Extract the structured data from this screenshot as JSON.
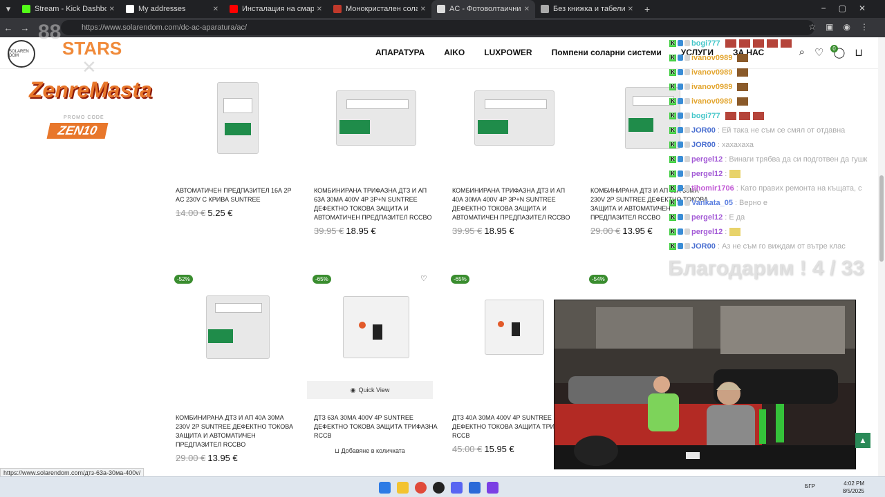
{
  "browser": {
    "tabs": [
      {
        "title": "Stream - Kick Dashboard",
        "color": "#53fc18"
      },
      {
        "title": "My addresses",
        "color": "#ffffff"
      },
      {
        "title": "Инсталация на смарт констру",
        "color": "#ff0000"
      },
      {
        "title": "Монокристален соларен пане",
        "color": "#c0392b"
      },
      {
        "title": "AC - Фотоволтаични инсталац",
        "color": "#dddddd"
      },
      {
        "title": "Без книжка и табели",
        "color": "#aaaaaa"
      }
    ],
    "url": "https://www.solarendom.com/dc-ac-aparatura/ac/"
  },
  "site": {
    "logo_text": "SOLAREN DOM",
    "menu": [
      "АПАРАТУРА",
      "AIKO",
      "LUXPOWER",
      "Помпени соларни системи",
      "УСЛУГИ",
      "ЗА НАС"
    ],
    "wishlist_count": "0"
  },
  "products_row1": [
    {
      "name": "АВТОМАТИЧЕН ПРЕДПАЗИТЕЛ 16А 2P AC 230V С КРИВА SUNTREE",
      "old_price": "14.00 €",
      "price": "5.25 €"
    },
    {
      "name": "КОМБИНИРАНА ТРИФАЗНА ДТЗ И АП 63А 30МА 400V 4P 3P+N SUNTREE ДЕФЕКТНО ТОКОВА ЗАЩИТА И АВТОМАТИЧЕН ПРЕДПАЗИТЕЛ RCCBO",
      "old_price": "39.95 €",
      "price": "18.95 €"
    },
    {
      "name": "КОМБИНИРАНА ТРИФАЗНА ДТЗ И АП 40А 30МА 400V 4P 3P+N SUNTREE ДЕФЕКТНО ТОКОВА ЗАЩИТА И АВТОМАТИЧЕН ПРЕДПАЗИТЕЛ RCCBO",
      "old_price": "39.95 €",
      "price": "18.95 €"
    },
    {
      "name": "КОМБИНИРАНА ДТЗ И АП 63А 30МА 230V 2P SUNTREE ДЕФЕКТНО ТОКОВА ЗАЩИТА И АВТОМАТИЧЕН ПРЕДПАЗИТЕЛ RCCBO",
      "old_price": "29.00 €",
      "price": "13.95 €"
    }
  ],
  "products_row2": [
    {
      "discount": "-52%",
      "name": "КОМБИНИРАНА ДТЗ И АП 40А 30МА 230V 2P SUNTREE ДЕФЕКТНО ТОКОВА ЗАЩИТА И АВТОМАТИЧЕН ПРЕДПАЗИТЕЛ RCCBO",
      "old_price": "29.00 €",
      "price": "13.95 €"
    },
    {
      "discount": "-65%",
      "name": "ДТЗ 63А 30МА 400V 4P SUNTREE ДЕФЕКТНО ТОКОВА ЗАЩИТА ТРИФАЗНА RCCB",
      "old_price": "",
      "price": ""
    },
    {
      "discount": "-65%",
      "name": "ДТЗ 40А 30МА 400V 4P SUNTREE ДЕФЕКТНО ТОКОВА ЗАЩИТА ТРИФАЗНА RCCB",
      "old_price": "45.00 €",
      "price": "15.95 €"
    },
    {
      "discount": "-54%",
      "name": "",
      "old_price": "",
      "price": ""
    }
  ],
  "quick_view": "Quick View",
  "add_to_cart": "Добавяне в количката",
  "overlay": {
    "num": "88",
    "stars": "STARS",
    "x_mark": "✕",
    "zen_title": "ZenreMasta",
    "promo": "PROMO CODE",
    "zen_code": "ZEN10",
    "thanks": "Благодарим ! 4 / 33"
  },
  "chat": [
    {
      "user": "bogi777",
      "msg": "",
      "color": "#43c6c9",
      "emotes": 5
    },
    {
      "user": "ivanov0989",
      "msg": "",
      "color": "#e3a630",
      "emotes": 1
    },
    {
      "user": "ivanov0989",
      "msg": "",
      "color": "#e3a630",
      "emotes": 1
    },
    {
      "user": "ivanov0989",
      "msg": "",
      "color": "#e3a630",
      "emotes": 1
    },
    {
      "user": "ivanov0989",
      "msg": "",
      "color": "#e3a630",
      "emotes": 1
    },
    {
      "user": "bogi777",
      "msg": "",
      "color": "#43c6c9",
      "emotes": 3
    },
    {
      "user": "JOR00",
      "msg": ": Ей така не съм се смял от отдавна",
      "color": "#4a6fd1",
      "emotes": 0
    },
    {
      "user": "JOR00",
      "msg": ": хахахаха",
      "color": "#4a6fd1",
      "emotes": 0
    },
    {
      "user": "pergel12",
      "msg": ": Винаги трябва да си подготвен да гушк",
      "color": "#a35ad6",
      "emotes": 0
    },
    {
      "user": "pergel12",
      "msg": ":",
      "color": "#a35ad6",
      "emotes": 1
    },
    {
      "user": "tihomir1706",
      "msg": ": Като правих ремонта на къщата, с",
      "color": "#c25ad6",
      "emotes": 0
    },
    {
      "user": "Vankata_05",
      "msg": ": Верно е",
      "color": "#5b7fe0",
      "emotes": 0
    },
    {
      "user": "pergel12",
      "msg": ": Е да",
      "color": "#a35ad6",
      "emotes": 0
    },
    {
      "user": "pergel12",
      "msg": ":",
      "color": "#a35ad6",
      "emotes": 1
    },
    {
      "user": "JOR00",
      "msg": ": Аз не съм го виждам от вътре клас",
      "color": "#4a6fd1",
      "emotes": 0
    }
  ],
  "status_url": "https://www.solarendom.com/дтз-63а-30ма-400v/",
  "taskbar": {
    "lang": "БГР",
    "time": "4:02 PM",
    "date": "8/5/2025"
  }
}
